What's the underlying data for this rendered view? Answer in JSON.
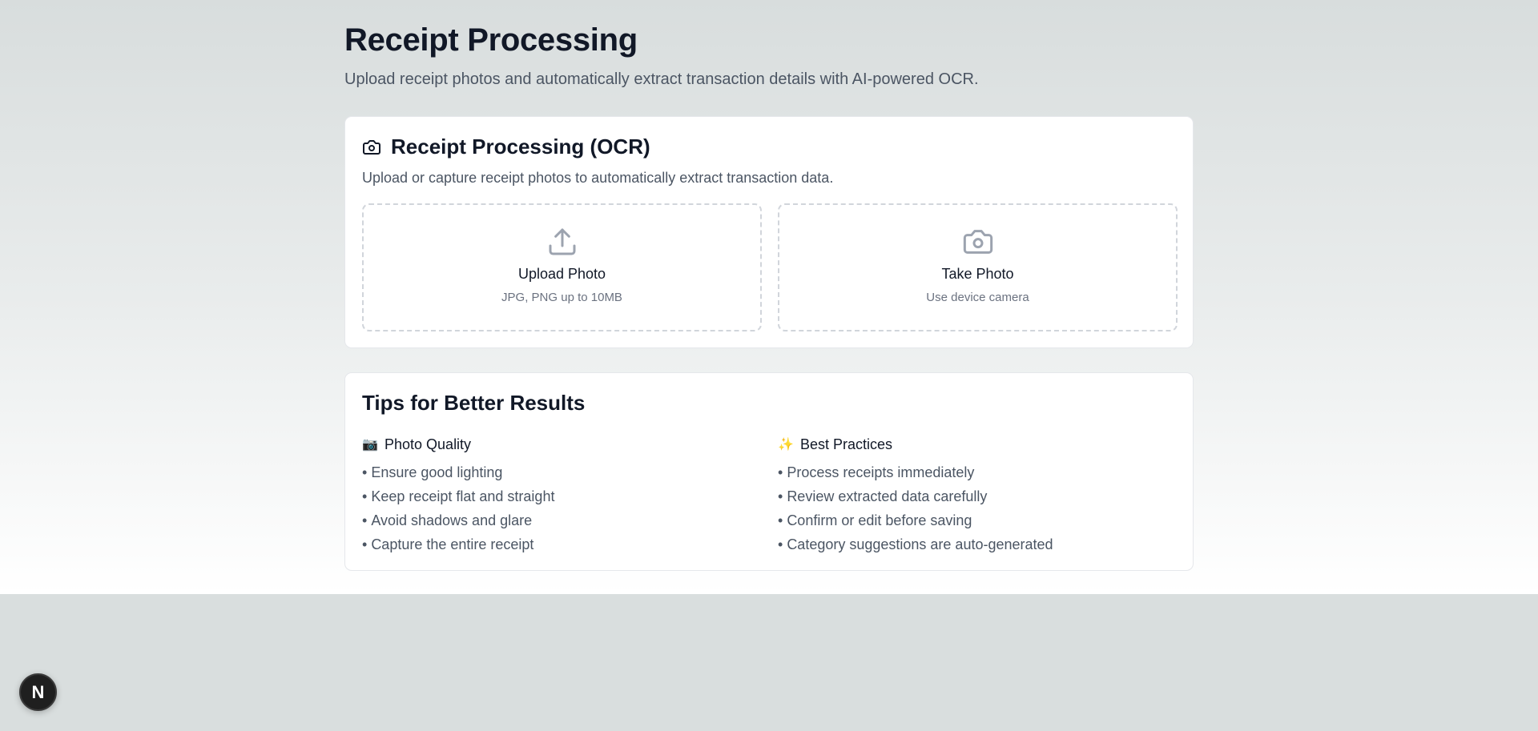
{
  "page": {
    "title": "Receipt Processing",
    "subtitle": "Upload receipt photos and automatically extract transaction details with AI-powered OCR."
  },
  "ocr_card": {
    "icon": "camera-icon",
    "title": "Receipt Processing (OCR)",
    "description": "Upload or capture receipt photos to automatically extract transaction data.",
    "upload": {
      "icon": "upload-icon",
      "label": "Upload Photo",
      "hint": "JPG, PNG up to 10MB"
    },
    "camera": {
      "icon": "camera-icon",
      "label": "Take Photo",
      "hint": "Use device camera"
    }
  },
  "tips_card": {
    "title": "Tips for Better Results",
    "photo_quality": {
      "emoji": "📷",
      "heading": "Photo Quality",
      "items": [
        "Ensure good lighting",
        "Keep receipt flat and straight",
        "Avoid shadows and glare",
        "Capture the entire receipt"
      ]
    },
    "best_practices": {
      "emoji": "✨",
      "heading": "Best Practices",
      "items": [
        "Process receipts immediately",
        "Review extracted data carefully",
        "Confirm or edit before saving",
        "Category suggestions are auto-generated"
      ]
    },
    "bullet": "•"
  },
  "dev_badge": {
    "label": "N",
    "icon": "nextjs-icon"
  },
  "colors": {
    "text_primary": "#111827",
    "text_secondary": "#4b5563",
    "text_muted": "#6b7280",
    "icon_gray": "#9ca3af",
    "card_bg": "#ffffff",
    "dashed_border": "#d1d5db"
  }
}
